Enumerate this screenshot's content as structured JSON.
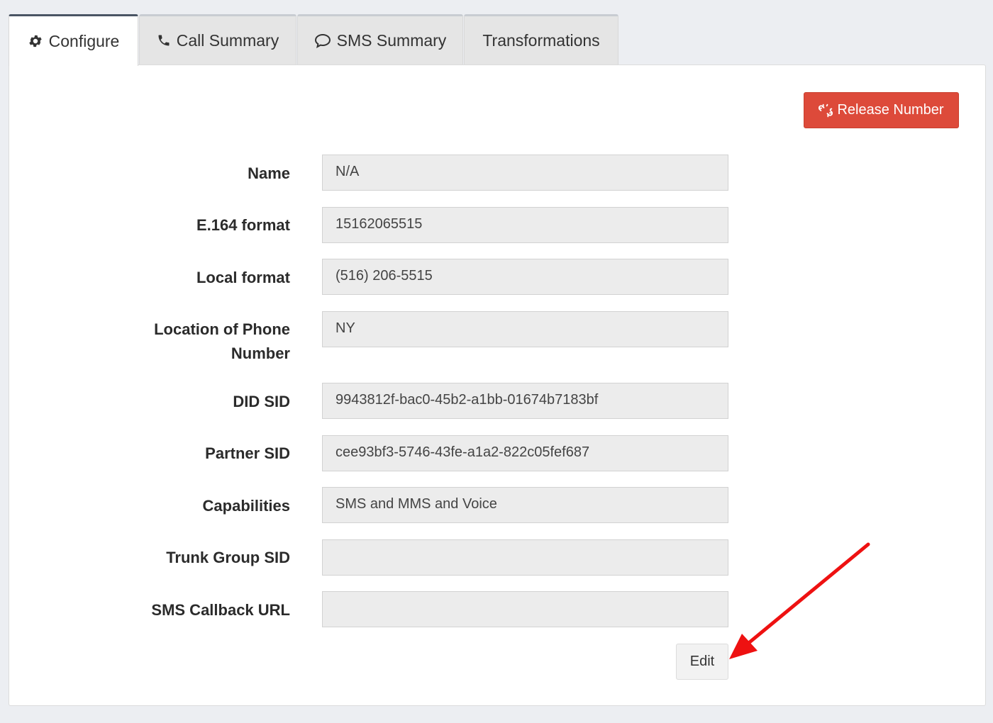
{
  "tabs": [
    {
      "label": "Configure",
      "icon": "gear-icon",
      "active": true
    },
    {
      "label": "Call Summary",
      "icon": "phone-icon",
      "active": false
    },
    {
      "label": "SMS Summary",
      "icon": "chat-bubble-icon",
      "active": false
    },
    {
      "label": "Transformations",
      "icon": "",
      "active": false
    }
  ],
  "actions": {
    "release_label": "Release Number",
    "release_icon": "unlink-icon",
    "edit_label": "Edit"
  },
  "fields": [
    {
      "label": "Name",
      "value": "N/A"
    },
    {
      "label": "E.164 format",
      "value": "15162065515"
    },
    {
      "label": "Local format",
      "value": "(516) 206-5515"
    },
    {
      "label": "Location of Phone Number",
      "value": "NY"
    },
    {
      "label": "DID SID",
      "value": "9943812f-bac0-45b2-a1bb-01674b7183bf"
    },
    {
      "label": "Partner SID",
      "value": "cee93bf3-5746-43fe-a1a2-822c05fef687"
    },
    {
      "label": "Capabilities",
      "value": "SMS and MMS and Voice"
    },
    {
      "label": "Trunk Group SID",
      "value": ""
    },
    {
      "label": "SMS Callback URL",
      "value": ""
    }
  ],
  "colors": {
    "danger": "#dd4a3a",
    "annotation_arrow": "#ee1111"
  }
}
